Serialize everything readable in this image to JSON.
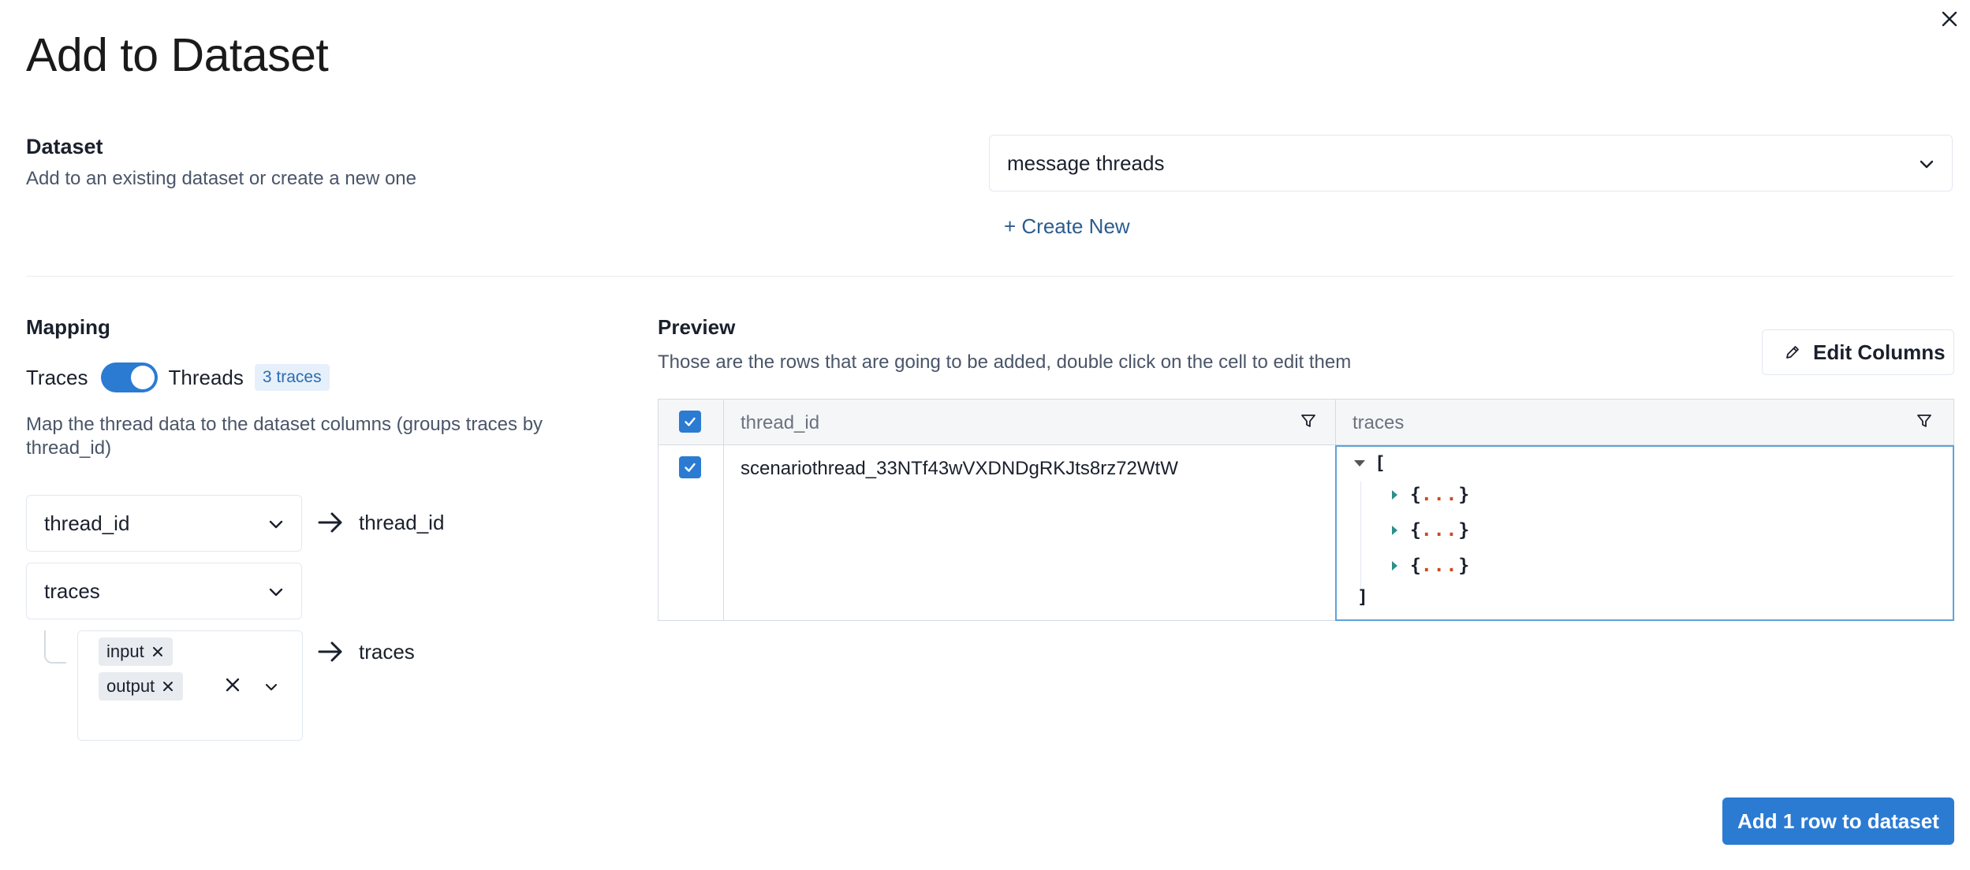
{
  "dialog": {
    "title": "Add to Dataset",
    "close_icon": "close-icon"
  },
  "dataset": {
    "label": "Dataset",
    "sublabel": "Add to an existing dataset or create a new one",
    "selected": "message threads",
    "create_new": "+ Create New"
  },
  "mapping": {
    "label": "Mapping",
    "toggle_left": "Traces",
    "toggle_right": "Threads",
    "toggle_on": true,
    "count_badge": "3 traces",
    "description": "Map the thread data to the dataset columns (groups traces by thread_id)",
    "rows": [
      {
        "source": "thread_id",
        "target": "thread_id"
      },
      {
        "source": "traces"
      }
    ],
    "subfields": {
      "tags": [
        "input",
        "output"
      ],
      "target": "traces"
    }
  },
  "preview": {
    "label": "Preview",
    "sublabel": "Those are the rows that are going to be added, double click on the cell to edit them",
    "edit_columns": "Edit Columns",
    "columns": [
      "thread_id",
      "traces"
    ],
    "rows": [
      {
        "checked": true,
        "thread_id": "scenariothread_33NTf43wVXDNDgRKJts8rz72WtW",
        "traces": {
          "open": "[",
          "items": [
            "{",
            "{",
            "{"
          ],
          "dots": "...",
          "item_close": "}",
          "close": "]"
        }
      }
    ],
    "header_checked": true
  },
  "footer": {
    "add_button": "Add 1 row to dataset"
  },
  "colors": {
    "accent": "#2b7bd3",
    "link": "#2b5d8f",
    "badge_bg": "#e6f0fb",
    "json_dots": "#c94a1f",
    "json_caret": "#2c8f8a"
  }
}
